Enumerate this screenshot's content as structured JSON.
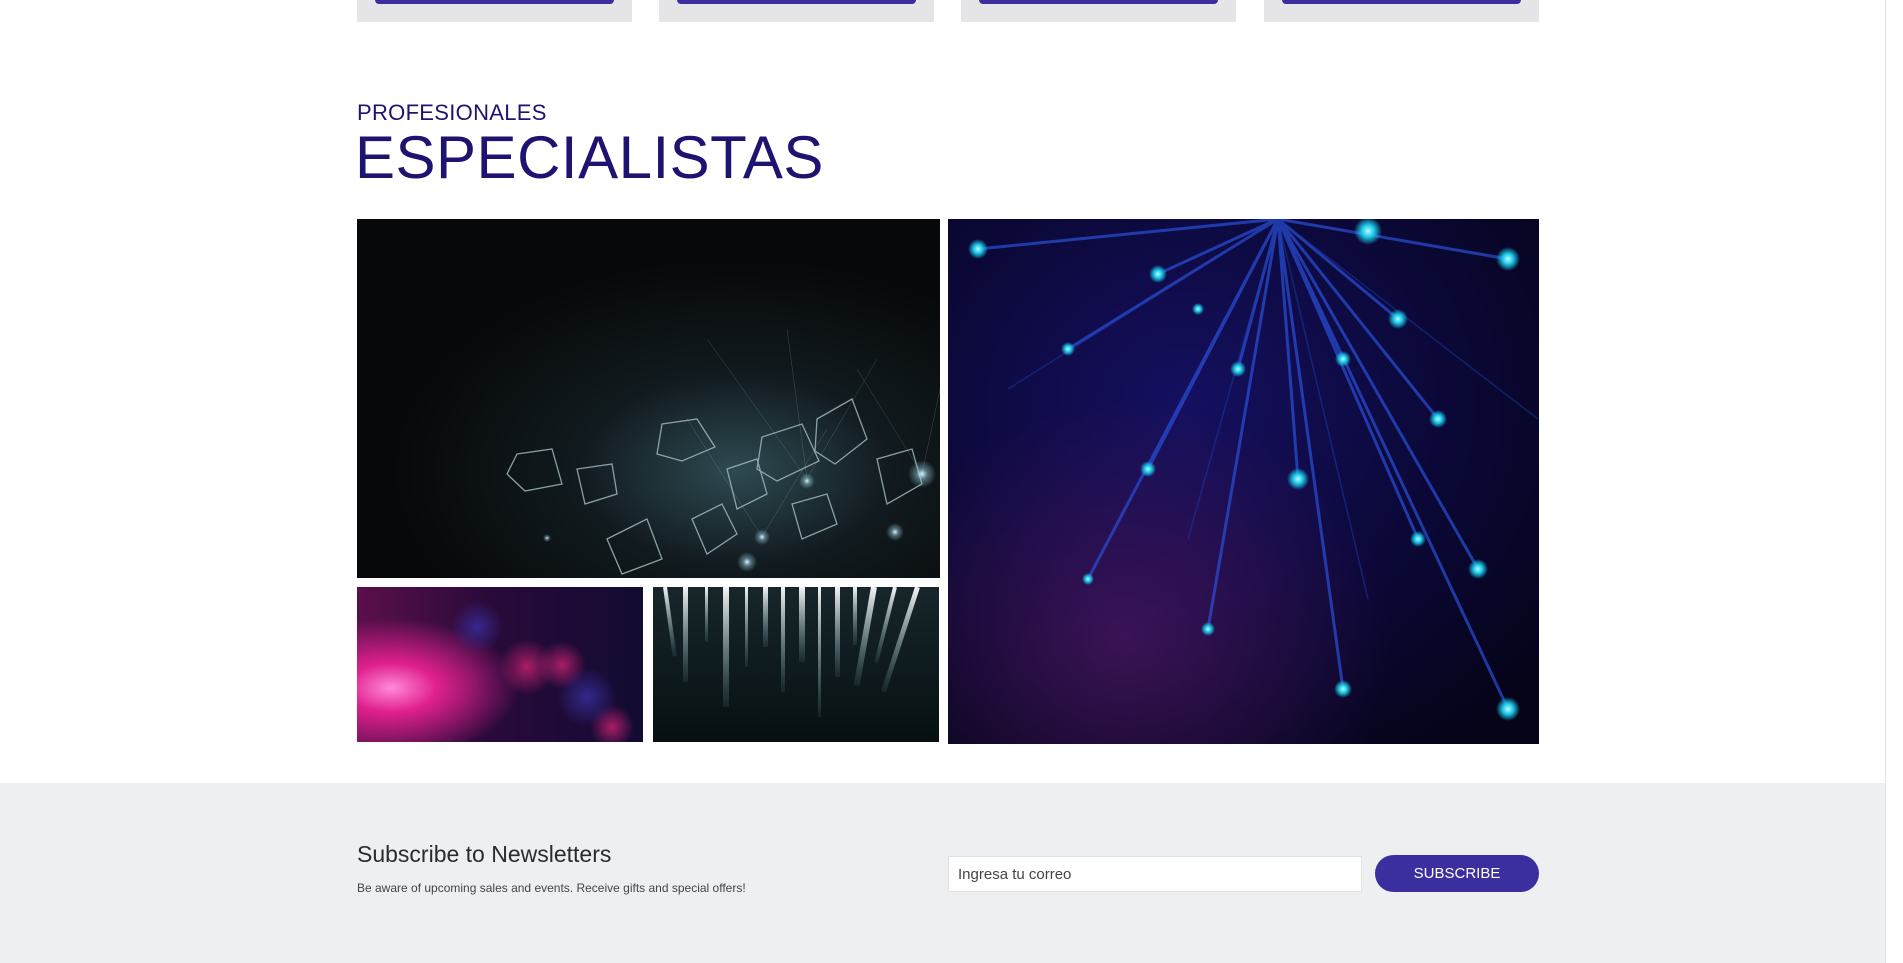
{
  "section": {
    "eyebrow": "PROFESIONALES",
    "title": "ESPECIALISTAS"
  },
  "gallery": {
    "images": [
      {
        "name": "hexagon-light-installation-image"
      },
      {
        "name": "fiber-optic-burst-image"
      },
      {
        "name": "pink-bokeh-image"
      },
      {
        "name": "light-streaks-image"
      }
    ]
  },
  "newsletter": {
    "title": "Subscribe to Newsletters",
    "subtitle": "Be aware of upcoming sales and events. Receive gifts and special offers!",
    "email_placeholder": "Ingresa tu correo",
    "button_label": "SUBSCRIBE"
  },
  "colors": {
    "accent": "#3b2fa0",
    "heading": "#1e1370",
    "footer_bg": "#eeeff1",
    "card_bg": "#e5e5e8"
  }
}
